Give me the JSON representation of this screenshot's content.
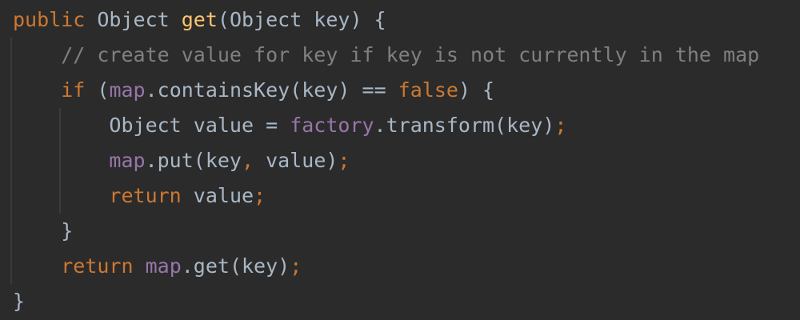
{
  "colors": {
    "background": "#2b2b2b",
    "keyword": "#cc7832",
    "method_declaration": "#ffc66d",
    "field": "#9876aa",
    "comment": "#808080",
    "default_text": "#a9b7c6",
    "indent_guide": "#3b3b3b"
  },
  "code": {
    "lines": [
      [
        {
          "text": "public",
          "type": "keyword"
        },
        {
          "text": " Object ",
          "type": "plain"
        },
        {
          "text": "get",
          "type": "method"
        },
        {
          "text": "(Object key) {",
          "type": "plain"
        }
      ],
      [
        {
          "text": "    ",
          "type": "plain"
        },
        {
          "text": "// create value for key if key is not currently in the map",
          "type": "comment"
        }
      ],
      [
        {
          "text": "    ",
          "type": "plain"
        },
        {
          "text": "if",
          "type": "keyword"
        },
        {
          "text": " (",
          "type": "plain"
        },
        {
          "text": "map",
          "type": "field"
        },
        {
          "text": ".containsKey(key) == ",
          "type": "plain"
        },
        {
          "text": "false",
          "type": "keyword"
        },
        {
          "text": ") {",
          "type": "plain"
        }
      ],
      [
        {
          "text": "        Object value = ",
          "type": "plain"
        },
        {
          "text": "factory",
          "type": "field"
        },
        {
          "text": ".transform(key)",
          "type": "plain"
        },
        {
          "text": ";",
          "type": "keyword"
        }
      ],
      [
        {
          "text": "        ",
          "type": "plain"
        },
        {
          "text": "map",
          "type": "field"
        },
        {
          "text": ".put(key",
          "type": "plain"
        },
        {
          "text": ",",
          "type": "keyword"
        },
        {
          "text": " value)",
          "type": "plain"
        },
        {
          "text": ";",
          "type": "keyword"
        }
      ],
      [
        {
          "text": "        ",
          "type": "plain"
        },
        {
          "text": "return",
          "type": "keyword"
        },
        {
          "text": " value",
          "type": "plain"
        },
        {
          "text": ";",
          "type": "keyword"
        }
      ],
      [
        {
          "text": "    }",
          "type": "plain"
        }
      ],
      [
        {
          "text": "    ",
          "type": "plain"
        },
        {
          "text": "return",
          "type": "keyword"
        },
        {
          "text": " ",
          "type": "plain"
        },
        {
          "text": "map",
          "type": "field"
        },
        {
          "text": ".get(key)",
          "type": "plain"
        },
        {
          "text": ";",
          "type": "keyword"
        }
      ],
      [
        {
          "text": "}",
          "type": "plain"
        }
      ]
    ]
  }
}
